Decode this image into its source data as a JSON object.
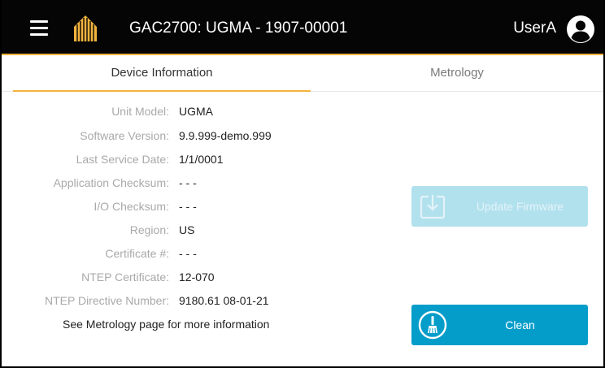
{
  "colors": {
    "header_bg": "#050505",
    "accent": "#f2b33d",
    "primary": "#049dca",
    "primary_disabled": "#b2e1ee",
    "label_gray": "#a9a9a9"
  },
  "header": {
    "menu_icon": "hamburger-menu-icon",
    "logo_icon": "company-logo-icon",
    "title": "GAC2700: UGMA - 1907-00001",
    "user_name": "UserA",
    "user_icon": "account-circle-icon"
  },
  "tabs": [
    {
      "label": "Device Information",
      "active": true
    },
    {
      "label": "Metrology",
      "active": false
    }
  ],
  "device_info": {
    "rows": [
      {
        "label": "Unit Model:",
        "value": "UGMA"
      },
      {
        "label": "Software Version:",
        "value": "9.9.999-demo.999"
      },
      {
        "label": "Last Service Date:",
        "value": "1/1/0001"
      },
      {
        "label": "Application Checksum:",
        "value": "- - -"
      },
      {
        "label": "I/O Checksum:",
        "value": "- - -"
      },
      {
        "label": "Region:",
        "value": "US"
      },
      {
        "label": "Certificate #:",
        "value": "- - -"
      },
      {
        "label": "NTEP Certificate:",
        "value": "12-070"
      },
      {
        "label": "NTEP Directive Number:",
        "value": "9180.61 08-01-21"
      }
    ],
    "footer_note": "See Metrology page for more information"
  },
  "actions": {
    "update_firmware": {
      "label": "Update Firmware",
      "enabled": false,
      "icon": "download-box-icon"
    },
    "clean": {
      "label": "Clean",
      "enabled": true,
      "icon": "broom-icon"
    }
  }
}
